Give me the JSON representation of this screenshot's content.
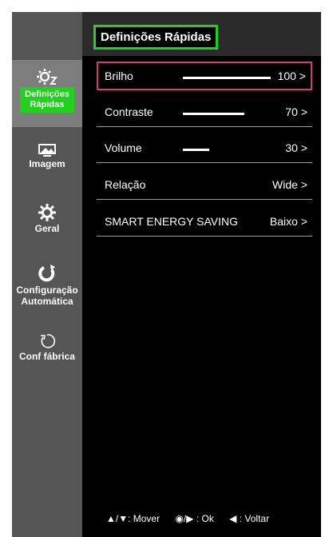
{
  "header": {
    "title": "Definições Rápidas"
  },
  "sidebar": {
    "items": [
      {
        "label_line1": "Definições",
        "label_line2": "Rápidas",
        "icon": "quick-settings-icon"
      },
      {
        "label": "Imagem",
        "icon": "picture-icon"
      },
      {
        "label": "Geral",
        "icon": "gear-icon"
      },
      {
        "label_line1": "Configuração",
        "label_line2": "Automática",
        "icon": "auto-config-icon"
      },
      {
        "label": "Conf fábrica",
        "icon": "reset-icon"
      }
    ]
  },
  "menu": {
    "rows": [
      {
        "label": "Brilho",
        "value": "100 >",
        "level": 100
      },
      {
        "label": "Contraste",
        "value": "70 >",
        "level": 70
      },
      {
        "label": "Volume",
        "value": "30 >",
        "level": 30
      },
      {
        "label": "Relação",
        "value": "Wide >"
      },
      {
        "label": "SMART ENERGY SAVING",
        "value": "Baixo >"
      }
    ]
  },
  "footer": {
    "move": "▲/▼: Mover",
    "ok": "◉/▶ : Ok",
    "back": "◀ : Voltar"
  },
  "colors": {
    "highlight": "#22d11e",
    "selection": "#d63d6c"
  }
}
